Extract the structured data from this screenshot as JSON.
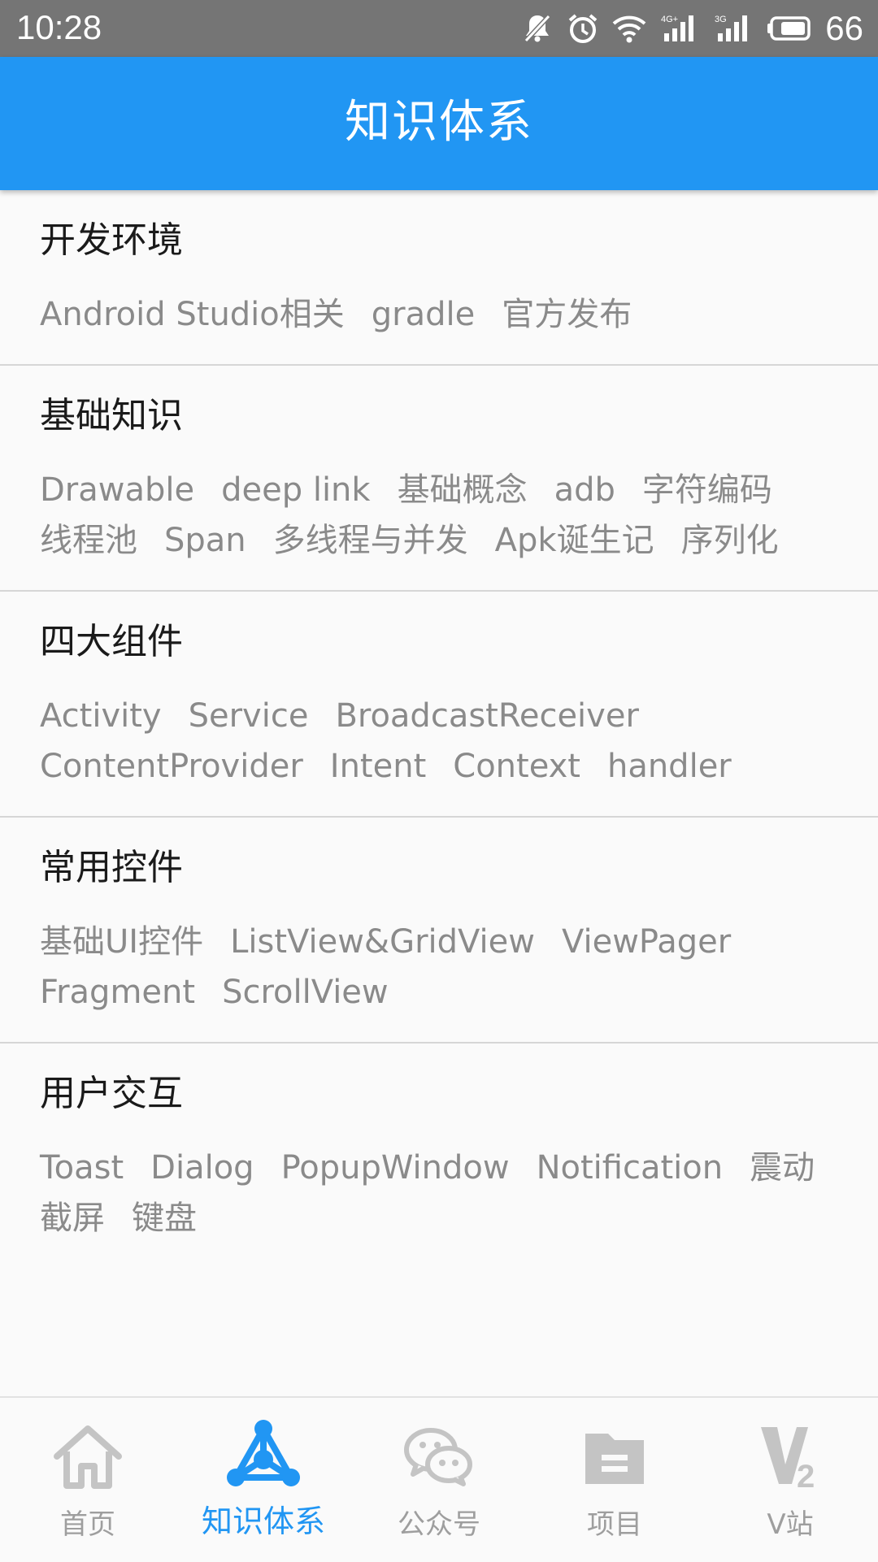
{
  "status_bar": {
    "time": "10:28",
    "network_4g": "4G+",
    "network_3g": "3G",
    "battery": "66",
    "icons": [
      "mute-icon",
      "alarm-icon",
      "wifi-icon",
      "signal-4g-icon",
      "signal-3g-icon",
      "battery-icon"
    ]
  },
  "app_bar": {
    "title": "知识体系"
  },
  "sections": [
    {
      "title": "开发环境",
      "tags": [
        "Android Studio相关",
        "gradle",
        "官方发布"
      ]
    },
    {
      "title": "基础知识",
      "tags": [
        "Drawable",
        "deep link",
        "基础概念",
        "adb",
        "字符编码",
        "线程池",
        "Span",
        "多线程与并发",
        "Apk诞生记",
        "序列化"
      ]
    },
    {
      "title": "四大组件",
      "tags": [
        "Activity",
        "Service",
        "BroadcastReceiver",
        "ContentProvider",
        "Intent",
        "Context",
        "handler"
      ]
    },
    {
      "title": "常用控件",
      "tags": [
        "基础UI控件",
        "ListView&GridView",
        "ViewPager",
        "Fragment",
        "ScrollView"
      ]
    },
    {
      "title": "用户交互",
      "tags": [
        "Toast",
        "Dialog",
        "PopupWindow",
        "Notification",
        "震动",
        "截屏",
        "键盘"
      ]
    }
  ],
  "bottom_nav": {
    "items": [
      {
        "label": "首页",
        "icon": "home-icon",
        "active": false
      },
      {
        "label": "知识体系",
        "icon": "tree-icon",
        "active": true
      },
      {
        "label": "公众号",
        "icon": "wechat-icon",
        "active": false
      },
      {
        "label": "项目",
        "icon": "folder-icon",
        "active": false
      },
      {
        "label": "V站",
        "icon": "v2-icon",
        "active": false
      }
    ]
  },
  "colors": {
    "primary": "#2196f3",
    "status_bar": "#757575",
    "tag_text": "#8a8a8a",
    "title_text": "#1a1a1a",
    "inactive_icon": "#c4c4c4"
  }
}
